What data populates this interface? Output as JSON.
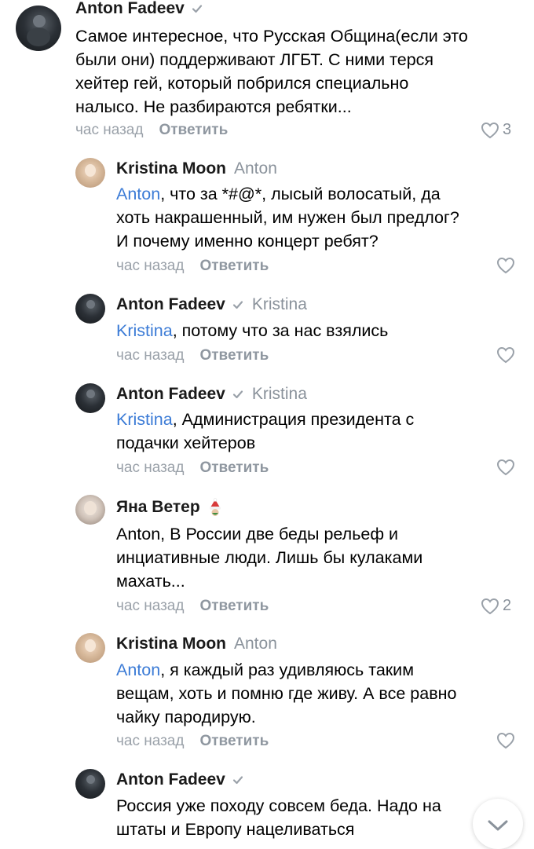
{
  "comments": [
    {
      "author": "Anton Fadeev",
      "verified": true,
      "reply_to": "",
      "mention": "",
      "text": "Самое интересное, что Русская Община(если это\nбыли они) поддерживают ЛГБТ. С ними терся\nхейтер гей, который побрился специально\nналысо. Не разбираются ребятки...",
      "time": "час назад",
      "reply_label": "Ответить",
      "likes": "3"
    },
    {
      "author": "Kristina Moon",
      "verified": false,
      "reply_to": "Anton",
      "mention": "Anton",
      "text": ",  что за *#@*, лысый волосатый, да\nхоть накрашенный,  им нужен был предлог?\nИ почему именно концерт ребят?",
      "time": "час назад",
      "reply_label": "Ответить",
      "likes": ""
    },
    {
      "author": "Anton Fadeev",
      "verified": true,
      "reply_to": "Kristina",
      "mention": "Kristina",
      "text": ", потому что за нас взялись",
      "time": "час назад",
      "reply_label": "Ответить",
      "likes": ""
    },
    {
      "author": "Anton Fadeev",
      "verified": true,
      "reply_to": "Kristina",
      "mention": "Kristina",
      "text": ", Администрация президента с\nподачки хейтеров",
      "time": "час назад",
      "reply_label": "Ответить",
      "likes": ""
    },
    {
      "author": "Яна Ветер",
      "verified": false,
      "reply_to": "",
      "mention": "",
      "text": "Anton, В России две беды рельеф и\nинциативные люди. Лишь бы кулаками\nмахать...",
      "time": "час назад",
      "reply_label": "Ответить",
      "likes": "2"
    },
    {
      "author": "Kristina Moon",
      "verified": false,
      "reply_to": "Anton",
      "mention": "Anton",
      "text": ", я каждый раз удивляюсь  таким\nвещам, хоть и помню где живу. А все равно\nчайку пародирую.",
      "time": "час назад",
      "reply_label": "Ответить",
      "likes": ""
    },
    {
      "author": "Anton Fadeev",
      "verified": true,
      "reply_to": "",
      "mention": "",
      "text": "Россия уже походу совсем беда. Надо на\nштаты и Европу нацеливаться",
      "time": "",
      "reply_label": "",
      "likes": ""
    }
  ],
  "icons": {
    "verified": "verified-check-icon",
    "like": "heart-icon",
    "scroll": "chevron-down-icon",
    "santa": "santa-hat-emoji"
  },
  "colors": {
    "mention": "#3b7bd6",
    "muted": "#9aa1a9"
  }
}
